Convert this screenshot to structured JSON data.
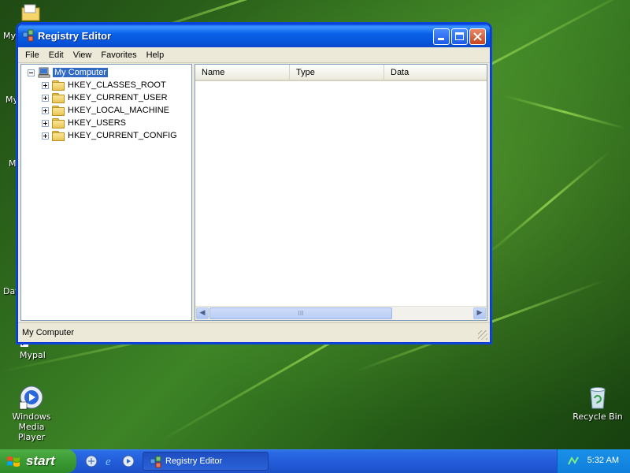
{
  "desktop": {
    "icons": [
      {
        "label": "My"
      },
      {
        "label": "My"
      },
      {
        "label": "My"
      },
      {
        "label": "Dat"
      },
      {
        "label": "Mypal"
      },
      {
        "label": "Windows Media"
      },
      {
        "label": "Player"
      },
      {
        "label": "Recycle Bin"
      }
    ]
  },
  "window": {
    "title": "Registry Editor",
    "menu": [
      "File",
      "Edit",
      "View",
      "Favorites",
      "Help"
    ],
    "tree": {
      "root": "My Computer",
      "keys": [
        "HKEY_CLASSES_ROOT",
        "HKEY_CURRENT_USER",
        "HKEY_LOCAL_MACHINE",
        "HKEY_USERS",
        "HKEY_CURRENT_CONFIG"
      ]
    },
    "list": {
      "columns": [
        "Name",
        "Type",
        "Data"
      ],
      "scroll_thumb_glyph": "III",
      "scroll_left_glyph": "◀",
      "scroll_right_glyph": "▶"
    },
    "status": "My Computer"
  },
  "taskbar": {
    "start_label": "start",
    "task_label": "Registry Editor",
    "clock": "5:32 AM"
  },
  "colors": {
    "titlebar": "#0554da",
    "selection": "#316ac5",
    "taskbar": "#245ddb",
    "start": "#3b9a33"
  }
}
